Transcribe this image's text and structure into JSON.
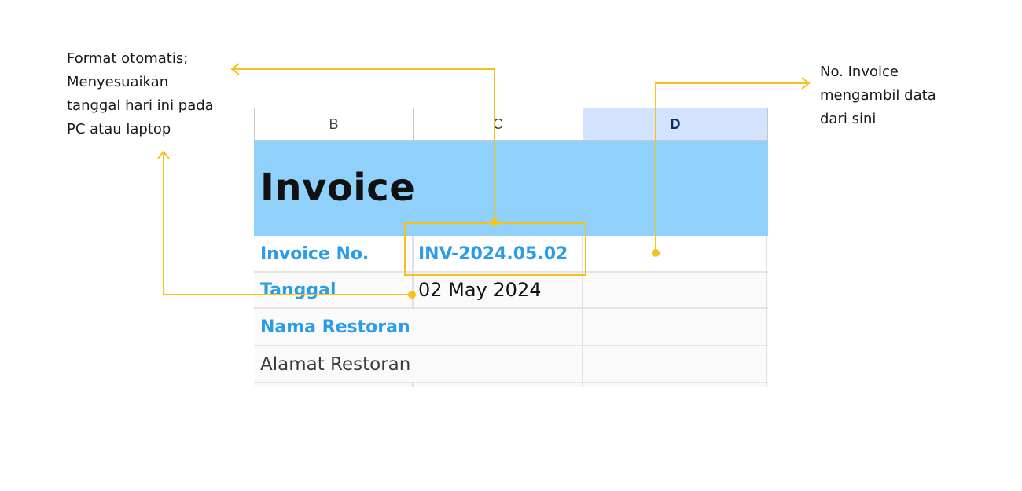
{
  "annotations": {
    "left_note": [
      "Format otomatis;",
      "Menyesuaikan",
      "tanggal hari ini pada",
      "PC atau laptop"
    ],
    "right_note": [
      "No. Invoice",
      "mengambil data",
      "dari sini"
    ],
    "accent_color": "#f5c21b"
  },
  "sheet": {
    "columns": [
      "B",
      "C",
      "D"
    ],
    "selected_column": "D",
    "title": "Invoice",
    "rows": [
      {
        "label": "Invoice No.",
        "value": "INV-2024.05.02"
      },
      {
        "label": "Tanggal",
        "value": "02 May 2024"
      },
      {
        "label": "Nama Restoran",
        "value": ""
      },
      {
        "label": "Alamat Restoran",
        "value": ""
      }
    ],
    "colors": {
      "title_band": "#90d1fb",
      "label_blue": "#2b9de8",
      "selected_header": "#d3e3fd"
    }
  }
}
